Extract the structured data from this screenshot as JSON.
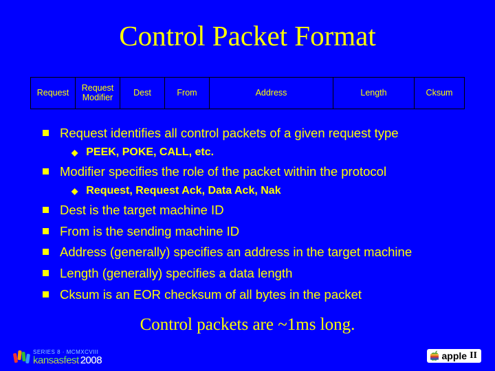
{
  "title": "Control Packet Format",
  "packet": {
    "request": "Request",
    "modifier": "Request\nModifier",
    "dest": "Dest",
    "from": "From",
    "address": "Address",
    "length": "Length",
    "cksum": "Cksum"
  },
  "bullets": [
    {
      "text": "Request identifies all control packets of a given request type",
      "sub": [
        "PEEK, POKE, CALL, etc."
      ]
    },
    {
      "text": "Modifier specifies the role of the packet within the protocol",
      "sub": [
        "Request, Request Ack, Data Ack, Nak"
      ]
    },
    {
      "text": "Dest is the target machine ID"
    },
    {
      "text": "From is the sending machine ID"
    },
    {
      "text": "Address (generally) specifies an address in the target machine"
    },
    {
      "text": "Length (generally) specifies a data length"
    },
    {
      "text": "Cksum is an EOR checksum of all bytes in the packet"
    }
  ],
  "tagline": "Control packets are ~1ms long.",
  "footer": {
    "kf_small": "SERIES 8 · MCMXCVIII",
    "kf_big": "kansasfest",
    "kf_year": "2008",
    "a2_label": "apple",
    "a2_suffix": "II"
  }
}
